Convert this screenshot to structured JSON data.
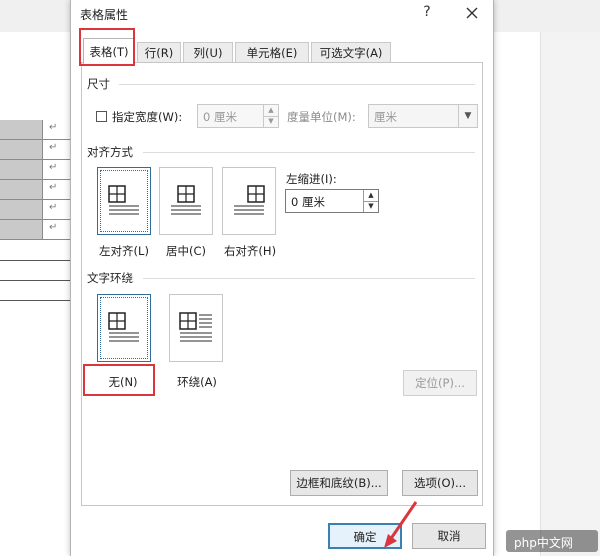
{
  "dialog": {
    "title": "表格属性",
    "help": "?",
    "tabs": [
      {
        "label": "表格(T)"
      },
      {
        "label": "行(R)"
      },
      {
        "label": "列(U)"
      },
      {
        "label": "单元格(E)"
      },
      {
        "label": "可选文字(A)"
      }
    ],
    "size": {
      "section": "尺寸",
      "specify_width": "指定宽度(W):",
      "width_value": "0 厘米",
      "unit_label": "度量单位(M):",
      "unit_value": "厘米"
    },
    "alignment": {
      "section": "对齐方式",
      "options": [
        {
          "label": "左对齐(L)"
        },
        {
          "label": "居中(C)"
        },
        {
          "label": "右对齐(H)"
        }
      ],
      "indent_label": "左缩进(I):",
      "indent_value": "0 厘米",
      "selected": "left"
    },
    "wrapping": {
      "section": "文字环绕",
      "options": [
        {
          "label": "无(N)"
        },
        {
          "label": "环绕(A)"
        }
      ],
      "selected": "none",
      "position_button": "定位(P)..."
    },
    "borders_button": "边框和底纹(B)...",
    "options_button": "选项(O)...",
    "ok_button": "确定",
    "cancel_button": "取消"
  },
  "document": {
    "paragraph_mark": "↵",
    "paragraph_marks": [
      "↵",
      "↵",
      "↵",
      "↵",
      "↵",
      "↵"
    ]
  },
  "watermark": "php中文网",
  "colors": {
    "highlight": "#d9363e",
    "selected_border": "#2f6e9c",
    "primary_border": "#3c7fb1"
  }
}
